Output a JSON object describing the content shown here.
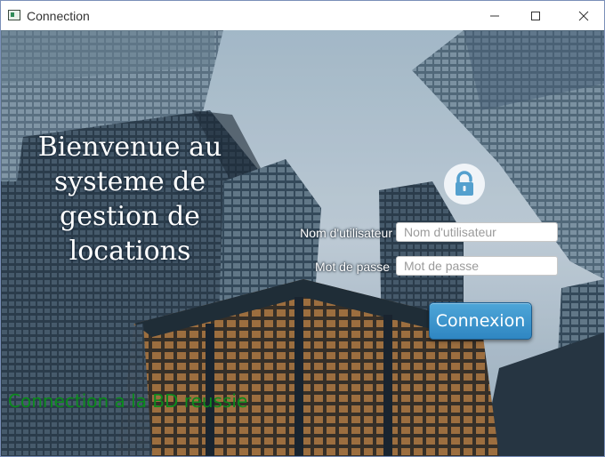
{
  "window": {
    "title": "Connection"
  },
  "welcome": {
    "lines": [
      "Bienvenue au",
      "systeme de",
      "gestion de",
      "locations"
    ]
  },
  "form": {
    "username_label": "Nom d'utilisateur",
    "username_placeholder": "Nom d'utilisateur",
    "username_value": "",
    "password_label": "Mot de passe",
    "password_placeholder": "Mot de passe",
    "password_value": "",
    "submit_label": "Connexion"
  },
  "status": {
    "message": "Connection a la BD reussie",
    "color": "#0b8a1c"
  },
  "icons": {
    "app": "app-window-icon",
    "lock": "lock-icon",
    "minimize": "minimize-icon",
    "maximize": "maximize-icon",
    "close": "close-icon"
  },
  "colors": {
    "button": "#3a95cf",
    "sky": "#c9dbe8"
  }
}
